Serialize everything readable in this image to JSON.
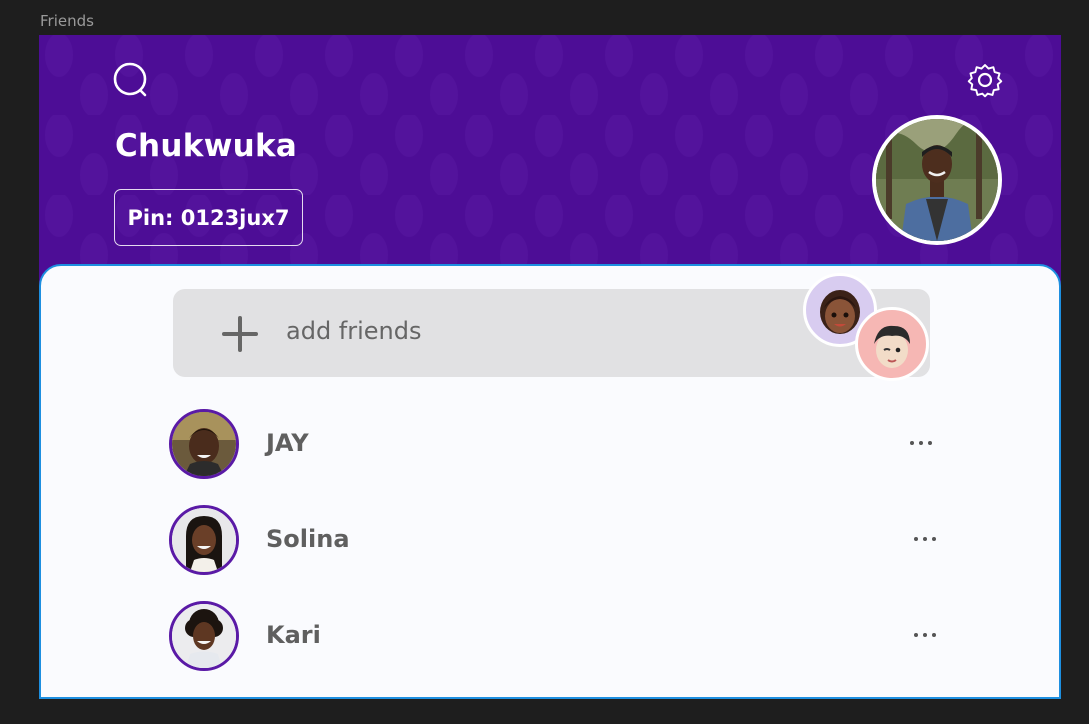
{
  "frame": {
    "label": "Friends"
  },
  "header": {
    "name": "Chukwuka",
    "pin": "Pin: 0123jux7",
    "search_icon": "search-icon",
    "settings_icon": "gear-icon"
  },
  "add_friends": {
    "label": "add friends",
    "icon": "plus-icon"
  },
  "friends": [
    {
      "name": "JAY"
    },
    {
      "name": "Solina"
    },
    {
      "name": "Kari"
    }
  ],
  "colors": {
    "header_bg": "#4d0d96",
    "card_bg": "#fafbfe",
    "selection": "#1d8fe0",
    "avatar_ring": "#5a1aa6"
  }
}
